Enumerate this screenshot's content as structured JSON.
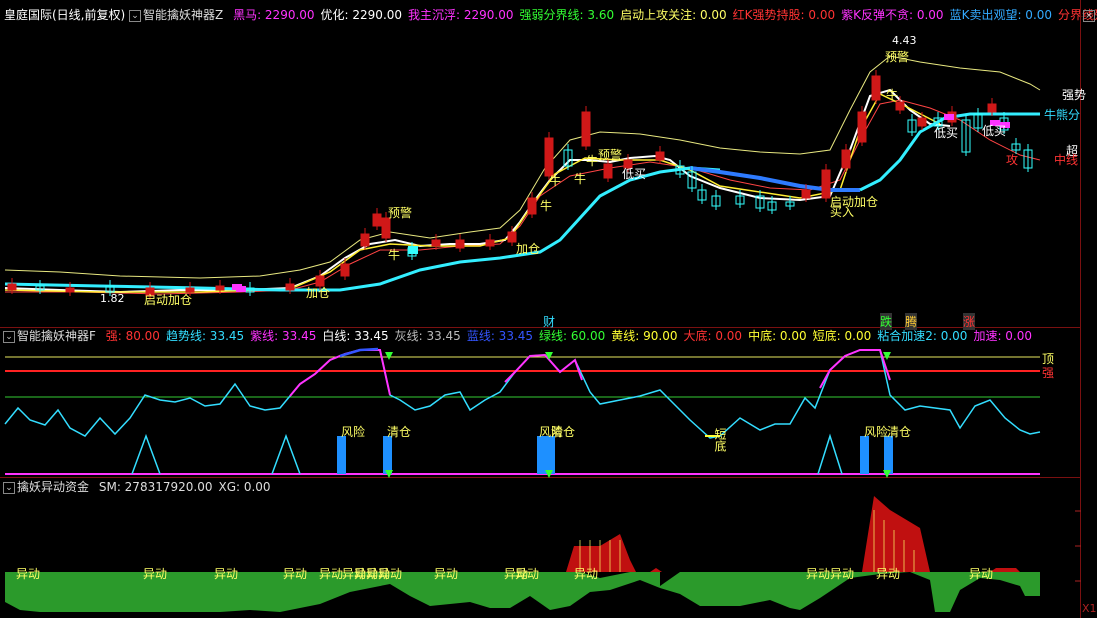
{
  "panel1": {
    "title": "皇庭国际(日线,前复权)",
    "indicator": "智能擒妖神器Z",
    "items": [
      {
        "t": "黑马: 2290.00",
        "c": "#ff33ff"
      },
      {
        "t": "优化: 2290.00",
        "c": "#ffffff"
      },
      {
        "t": "我主沉浮: 2290.00",
        "c": "#ff33ff"
      },
      {
        "t": "强弱分界线: 3.60",
        "c": "#33ff33"
      },
      {
        "t": "启动上攻关注: 0.00",
        "c": "#ffff66"
      },
      {
        "t": "红K强势持股: 0.00",
        "c": "#ff3333"
      },
      {
        "t": "紫K反弹不贪: 0.00",
        "c": "#ff33ff"
      },
      {
        "t": "蓝K卖出观望: 0.00",
        "c": "#33aaff"
      },
      {
        "t": "分界线殁◇",
        "c": "#ff3333"
      }
    ],
    "labels": {
      "high": "4.43",
      "low": "1.82",
      "yujing": "预警",
      "niu": "牛",
      "jiacang": "加仓",
      "qidong": "启动",
      "dimai": "低买",
      "qidong_jiacang": "启动加仓",
      "mairu": "买入",
      "qiang": "强势",
      "chao": "超",
      "zhong": "中线",
      "niu_xiong": "牛熊分",
      "gong": "攻",
      "cai": "财",
      "die": "跌",
      "teng": "腾",
      "zhang": "涨"
    }
  },
  "panel2": {
    "indicator": "智能擒妖神器F",
    "items": [
      {
        "t": "强: 80.00",
        "c": "#ff3333"
      },
      {
        "t": "趋势线: 33.45",
        "c": "#33ddff"
      },
      {
        "t": "紫线: 33.45",
        "c": "#ff33ff"
      },
      {
        "t": "白线: 33.45",
        "c": "#ffffff"
      },
      {
        "t": "灰线: 33.45",
        "c": "#bbbbbb"
      },
      {
        "t": "蓝线: 33.45",
        "c": "#3355ff"
      },
      {
        "t": "绿线: 60.00",
        "c": "#33ff33"
      },
      {
        "t": "黄线: 90.00",
        "c": "#ffff33"
      },
      {
        "t": "大底: 0.00",
        "c": "#ff3333"
      },
      {
        "t": "中底: 0.00",
        "c": "#ffff33"
      },
      {
        "t": "短底: 0.00",
        "c": "#ffff33"
      },
      {
        "t": "粘合加速2: 0.00",
        "c": "#33ddff"
      },
      {
        "t": "加速: 0.00",
        "c": "#ff33ff"
      }
    ],
    "labels": {
      "ding": "顶",
      "qiang": "强",
      "fengxian": "风险",
      "qingcang": "清仓",
      "duandi": "短底"
    }
  },
  "panel3": {
    "indicator": "擒妖异动资金",
    "items": [
      {
        "t": "SM: 278317920.00",
        "c": "#dddddd"
      },
      {
        "t": "XG: 0.00",
        "c": "#dddddd"
      }
    ],
    "labels": {
      "yidong": "异动"
    },
    "corner": "X1"
  },
  "colors": {
    "bg": "#000000",
    "up": "#ff2222",
    "down": "#33ffff",
    "grid": "#7a1010"
  }
}
